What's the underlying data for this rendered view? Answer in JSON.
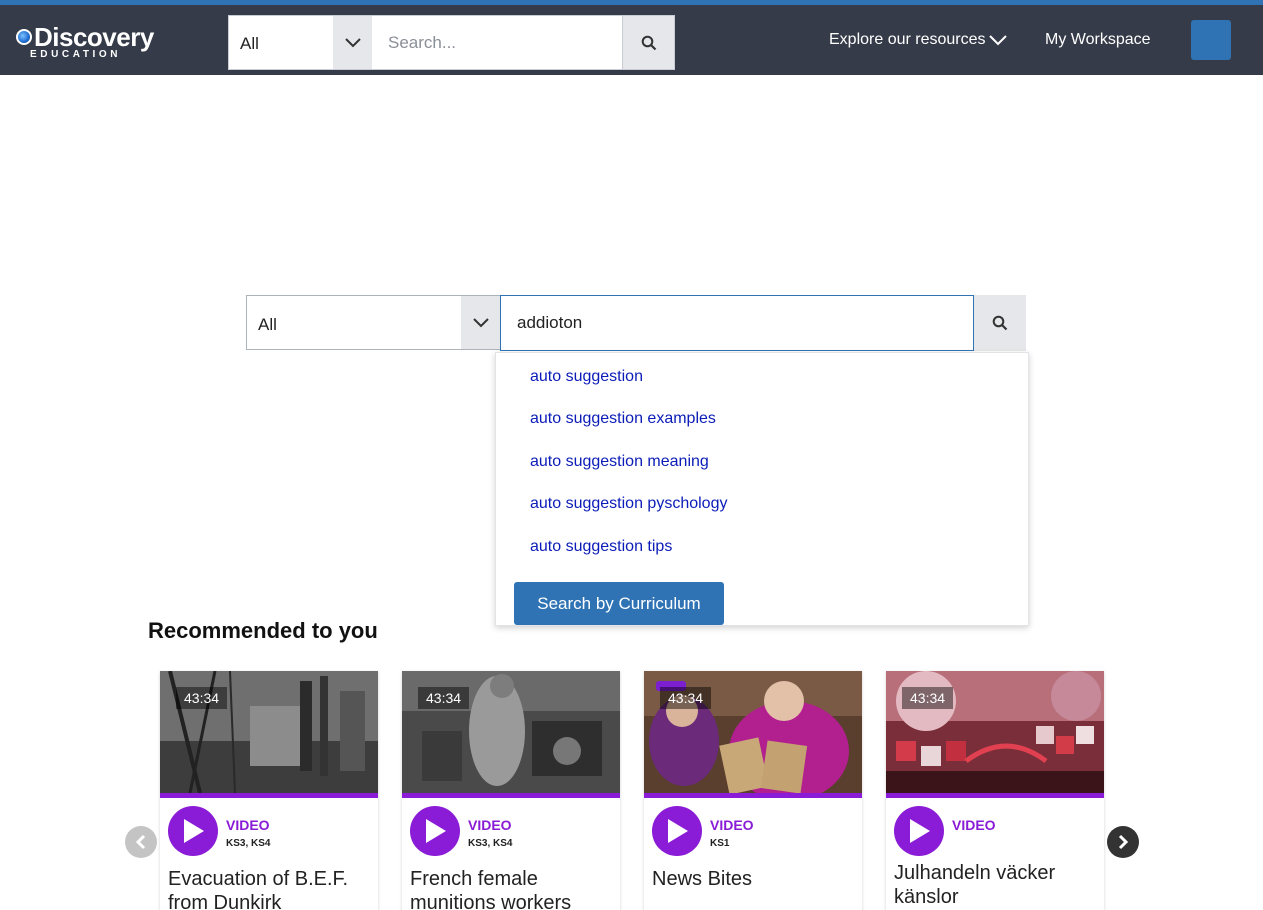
{
  "header": {
    "logo": {
      "word": "Discovery",
      "sub": "EDUCATION"
    },
    "search": {
      "scope": "All",
      "placeholder": "Search..."
    },
    "nav": {
      "explore": "Explore our resources",
      "workspace": "My Workspace"
    }
  },
  "main_search": {
    "scope": "All",
    "query": "addioton",
    "suggestions": [
      "auto suggestion",
      "auto suggestion examples",
      "auto suggestion meaning",
      "auto suggestion pyschology",
      "auto suggestion tips"
    ],
    "curriculum_button": "Search by Curriculum"
  },
  "recommended": {
    "title": "Recommended to you",
    "cards": [
      {
        "duration": "43:34",
        "type": "VIDEO",
        "level": "KS3, KS4",
        "title": "Evacuation of B.E.F. from Dunkirk"
      },
      {
        "duration": "43:34",
        "type": "VIDEO",
        "level": "KS3, KS4",
        "title": "French female munitions workers"
      },
      {
        "duration": "43:34",
        "type": "VIDEO",
        "level": "KS1",
        "title": "News Bites"
      },
      {
        "duration": "43:34",
        "type": "VIDEO",
        "level": "",
        "title": "Julhandeln väcker känslor"
      }
    ]
  },
  "colors": {
    "header_bg": "#353b48",
    "accent_blue": "#2f73b5",
    "video_purple": "#8a1bd6",
    "suggestion_link": "#0b1cb8"
  }
}
